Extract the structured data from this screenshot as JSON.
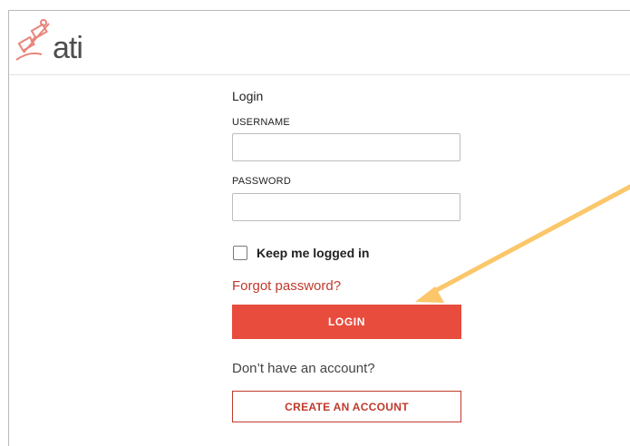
{
  "header": {
    "logo_text": "ati"
  },
  "form": {
    "title": "Login",
    "username_label": "USERNAME",
    "username_value": "",
    "password_label": "PASSWORD",
    "password_value": "",
    "remember_label": "Keep me logged in",
    "remember_checked": false,
    "forgot_link": "Forgot password?",
    "login_button": "LOGIN",
    "no_account_text": "Don’t have an account?",
    "create_account_button": "CREATE AN ACCOUNT"
  },
  "colors": {
    "accent_red": "#e74c3c",
    "link_red": "#c0392b",
    "annotation_arrow": "#fbc76a"
  },
  "icons": {
    "logo": "satellite-logo-icon",
    "annotation": "arrow-annotation-icon"
  }
}
